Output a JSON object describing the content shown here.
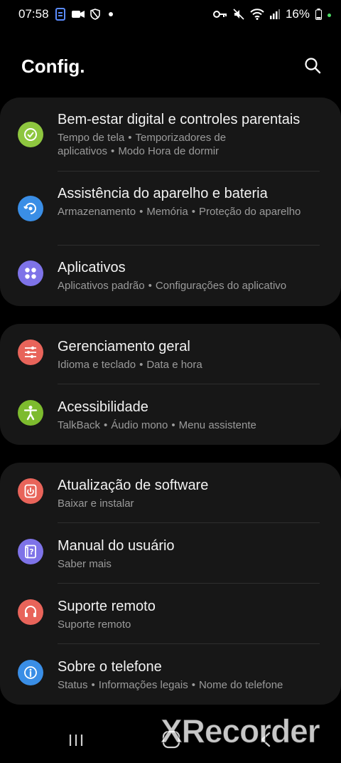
{
  "status_bar": {
    "time": "07:58",
    "battery": "16%",
    "left_icons": [
      "sync-icon",
      "video-icon",
      "shield-icon",
      "dot"
    ],
    "right_icons": [
      "key-icon",
      "mute-icon",
      "wifi-icon",
      "signal-icon",
      "battery-icon"
    ]
  },
  "header": {
    "title": "Config."
  },
  "groups": [
    {
      "items": [
        {
          "title": "Bem-estar digital e controles parentais",
          "subtitle_parts": [
            "Tempo de tela",
            "Temporizadores de aplicativos",
            "Modo Hora de dormir"
          ],
          "icon": "digital-wellbeing-icon",
          "icon_color": "#8ec63f"
        },
        {
          "title": "Assistência do aparelho e bateria",
          "subtitle_parts": [
            "Armazenamento",
            "Memória",
            "Proteção do aparelho"
          ],
          "icon": "device-care-icon",
          "icon_color": "#3a8ee6"
        },
        {
          "title": "Aplicativos",
          "subtitle_parts": [
            "Aplicativos padrão",
            "Configurações do aplicativo"
          ],
          "icon": "apps-icon",
          "icon_color": "#7e73e8"
        }
      ]
    },
    {
      "items": [
        {
          "title": "Gerenciamento geral",
          "subtitle_parts": [
            "Idioma e teclado",
            "Data e hora"
          ],
          "icon": "general-management-icon",
          "icon_color": "#e8645a"
        },
        {
          "title": "Acessibilidade",
          "subtitle_parts": [
            "TalkBack",
            "Áudio mono",
            "Menu assistente"
          ],
          "icon": "accessibility-icon",
          "icon_color": "#7dbb2e"
        }
      ]
    },
    {
      "items": [
        {
          "title": "Atualização de software",
          "subtitle_parts": [
            "Baixar e instalar"
          ],
          "icon": "software-update-icon",
          "icon_color": "#e8645a"
        },
        {
          "title": "Manual do usuário",
          "subtitle_parts": [
            "Saber mais"
          ],
          "icon": "user-manual-icon",
          "icon_color": "#7e73e8"
        },
        {
          "title": "Suporte remoto",
          "subtitle_parts": [
            "Suporte remoto"
          ],
          "icon": "remote-support-icon",
          "icon_color": "#e8645a"
        },
        {
          "title": "Sobre o telefone",
          "subtitle_parts": [
            "Status",
            "Informações legais",
            "Nome do telefone"
          ],
          "icon": "about-phone-icon",
          "icon_color": "#3a8ee6"
        }
      ]
    }
  ],
  "watermark": "XRecorder",
  "separator": "•"
}
